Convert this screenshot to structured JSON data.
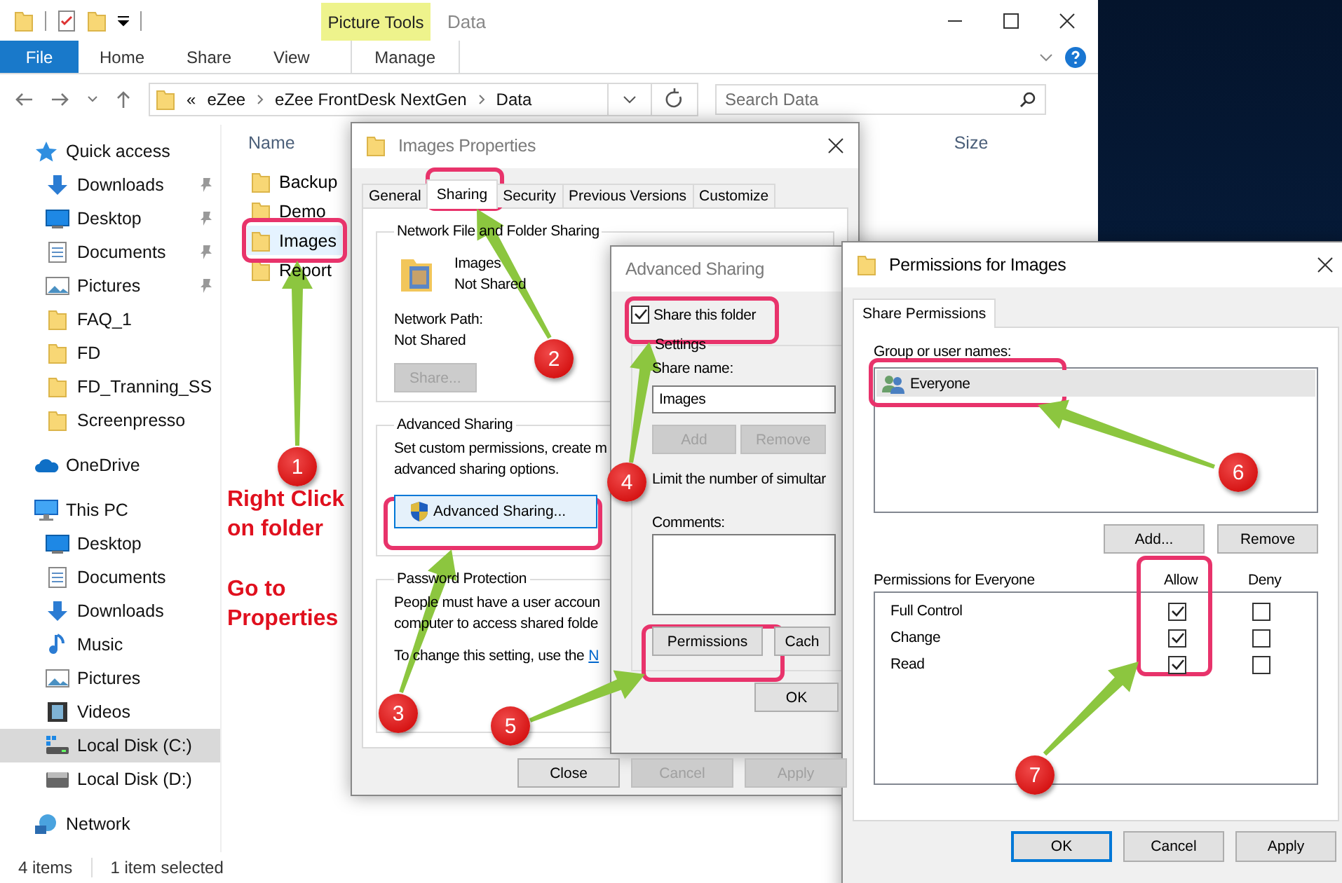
{
  "explorer": {
    "context_tab": "Picture Tools",
    "title": "Data",
    "ribbon_tabs": [
      {
        "label": "File",
        "selected": false,
        "kind": "file"
      },
      {
        "label": "Home",
        "selected": false,
        "kind": "tab"
      },
      {
        "label": "Share",
        "selected": false,
        "kind": "tab"
      },
      {
        "label": "View",
        "selected": false,
        "kind": "tab"
      },
      {
        "label": "Manage",
        "selected": false,
        "kind": "context"
      }
    ],
    "breadcrumb_prefix": "«",
    "breadcrumb": [
      "eZee",
      "eZee FrontDesk NextGen",
      "Data"
    ],
    "search": {
      "placeholder": "Search Data"
    },
    "nav": [
      {
        "label": "Quick access",
        "kind": "star",
        "selected": false,
        "children": [
          {
            "label": "Downloads",
            "kind": "downloads",
            "pinned": true,
            "selected": false
          },
          {
            "label": "Desktop",
            "kind": "desktop",
            "pinned": true,
            "selected": false
          },
          {
            "label": "Documents",
            "kind": "documents",
            "pinned": true,
            "selected": false
          },
          {
            "label": "Pictures",
            "kind": "pictures",
            "pinned": true,
            "selected": false
          },
          {
            "label": "FAQ_1",
            "kind": "folder",
            "pinned": false,
            "selected": false
          },
          {
            "label": "FD",
            "kind": "folder",
            "pinned": false,
            "selected": false
          },
          {
            "label": "FD_Tranning_SS",
            "kind": "folder",
            "pinned": false,
            "selected": false
          },
          {
            "label": "Screenpresso",
            "kind": "folder",
            "pinned": false,
            "selected": false
          }
        ]
      },
      {
        "label": "OneDrive",
        "kind": "cloud",
        "selected": false
      },
      {
        "label": "This PC",
        "kind": "pc",
        "selected": false,
        "children": [
          {
            "label": "Desktop",
            "kind": "desktop",
            "pinned": false,
            "selected": false
          },
          {
            "label": "Documents",
            "kind": "documents",
            "pinned": false,
            "selected": false
          },
          {
            "label": "Downloads",
            "kind": "downloads",
            "pinned": false,
            "selected": false
          },
          {
            "label": "Music",
            "kind": "music",
            "pinned": false,
            "selected": false
          },
          {
            "label": "Pictures",
            "kind": "pictures",
            "pinned": false,
            "selected": false
          },
          {
            "label": "Videos",
            "kind": "videos",
            "pinned": false,
            "selected": false
          },
          {
            "label": "Local Disk (C:)",
            "kind": "system-drive",
            "pinned": false,
            "selected": true
          },
          {
            "label": "Local Disk (D:)",
            "kind": "drive",
            "pinned": false,
            "selected": false
          }
        ]
      },
      {
        "label": "Network",
        "kind": "network",
        "selected": false
      }
    ],
    "columns": [
      "Name",
      "Size"
    ],
    "files": [
      {
        "name": "Backup",
        "selected": false
      },
      {
        "name": "Demo",
        "selected": false
      },
      {
        "name": "Images",
        "selected": true
      },
      {
        "name": "Report",
        "selected": false
      }
    ],
    "status_bar": [
      "4 items",
      "1 item selected"
    ]
  },
  "properties_dialog": {
    "title": "Images Properties",
    "tabs": [
      {
        "label": "General",
        "selected": false
      },
      {
        "label": "Sharing",
        "selected": true
      },
      {
        "label": "Security",
        "selected": false
      },
      {
        "label": "Previous Versions",
        "selected": false
      },
      {
        "label": "Customize",
        "selected": false
      }
    ],
    "network_group": {
      "title": "Network File and Folder Sharing",
      "name": "Images",
      "status": "Not Shared",
      "path_label": "Network Path:",
      "path": "Not Shared",
      "button": {
        "label": "Share...",
        "disabled": true
      }
    },
    "advanced_group": {
      "title": "Advanced Sharing",
      "lines": [
        "Set custom permissions, create m",
        "advanced sharing options."
      ],
      "button": {
        "label": "Advanced Sharing...",
        "disabled": false
      }
    },
    "password_group": {
      "title": "Password Protection",
      "lines": [
        "People must have a user accoun",
        "computer to access shared folde"
      ],
      "setting_text": "To change this setting, use the",
      "link": "N"
    },
    "buttons": [
      {
        "label": "Close",
        "disabled": false
      },
      {
        "label": "Cancel",
        "disabled": true
      },
      {
        "label": "Apply",
        "disabled": true
      }
    ]
  },
  "advanced_dialog": {
    "title": "Advanced Sharing",
    "share_checkbox": {
      "label": "Share this folder",
      "checked": true
    },
    "settings_title": "Settings",
    "share_name_label": "Share name:",
    "share_name": "Images",
    "name_buttons": [
      {
        "label": "Add",
        "disabled": true
      },
      {
        "label": "Remove",
        "disabled": true
      }
    ],
    "limit_text": "Limit the number of simultar",
    "comments_label": "Comments:",
    "action_buttons": [
      {
        "label": "Permissions",
        "disabled": false
      },
      {
        "label": "Cach",
        "disabled": false
      }
    ],
    "ok_button": "OK"
  },
  "permissions_dialog": {
    "title": "Permissions for Images",
    "tabs": [
      {
        "label": "Share Permissions",
        "selected": true
      }
    ],
    "group_label": "Group or user names:",
    "users": [
      {
        "name": "Everyone",
        "selected": true
      }
    ],
    "user_buttons": [
      "Add...",
      "Remove"
    ],
    "permissions_label": "Permissions for Everyone",
    "allow_label": "Allow",
    "deny_label": "Deny",
    "permissions": [
      {
        "name": "Full Control",
        "allow": true,
        "deny": false
      },
      {
        "name": "Change",
        "allow": true,
        "deny": false
      },
      {
        "name": "Read",
        "allow": true,
        "deny": false
      }
    ],
    "buttons": [
      {
        "label": "OK",
        "default": true
      },
      {
        "label": "Cancel",
        "default": false
      },
      {
        "label": "Apply",
        "default": false
      }
    ]
  },
  "annotations": {
    "steps": [
      "1",
      "2",
      "3",
      "4",
      "5",
      "6",
      "7"
    ],
    "notes": [
      "Right Click on folder",
      "Go to Properties"
    ]
  }
}
